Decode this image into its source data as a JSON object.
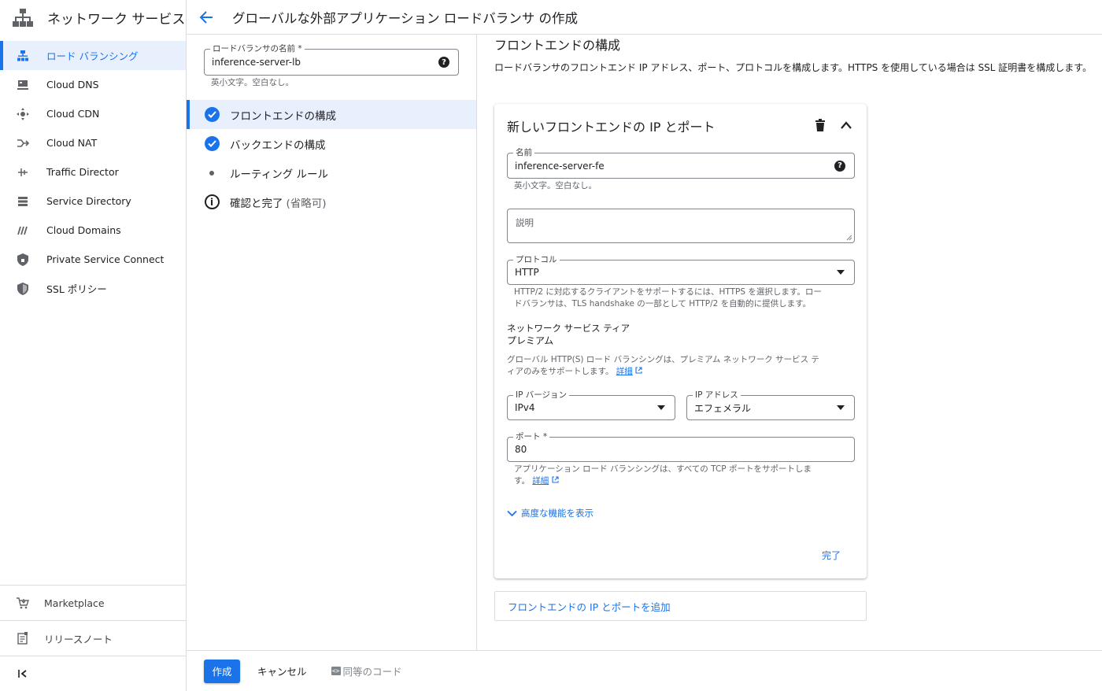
{
  "app": {
    "title": "ネットワーク サービス"
  },
  "sidebar": {
    "items": [
      {
        "label": "ロード バランシング",
        "icon": "load-balancer-icon",
        "active": true
      },
      {
        "label": "Cloud DNS",
        "icon": "dns-icon"
      },
      {
        "label": "Cloud CDN",
        "icon": "cdn-icon"
      },
      {
        "label": "Cloud NAT",
        "icon": "nat-icon"
      },
      {
        "label": "Traffic Director",
        "icon": "traffic-director-icon"
      },
      {
        "label": "Service Directory",
        "icon": "service-directory-icon"
      },
      {
        "label": "Cloud Domains",
        "icon": "domains-icon"
      },
      {
        "label": "Private Service Connect",
        "icon": "private-service-connect-icon"
      },
      {
        "label": "SSL ポリシー",
        "icon": "ssl-policy-icon"
      }
    ],
    "marketplace": "Marketplace",
    "release_notes": "リリースノート",
    "collapse_icon": "collapse-sidebar-icon"
  },
  "header": {
    "title": "グローバルな外部アプリケーション ロードバランサ の作成",
    "back_icon": "back-arrow-icon"
  },
  "lb_name": {
    "label": "ロードバランサの名前 *",
    "value": "inference-server-lb",
    "hint": "英小文字。空白なし。"
  },
  "steps": [
    {
      "label": "フロントエンドの構成",
      "state": "done",
      "active": true
    },
    {
      "label": "バックエンドの構成",
      "state": "done"
    },
    {
      "label": "ルーティング ルール",
      "state": "pending"
    },
    {
      "label": "確認と完了",
      "suffix": "(省略可)",
      "state": "info"
    }
  ],
  "main": {
    "heading": "フロントエンドの構成",
    "description": "ロードバランサのフロントエンド IP アドレス、ポート、プロトコルを構成します。HTTPS を使用している場合は SSL 証明書を構成します。",
    "card": {
      "title": "新しいフロントエンドの IP とポート",
      "name_label": "名前",
      "name_value": "inference-server-fe",
      "name_hint": "英小文字。空白なし。",
      "description_placeholder": "説明",
      "protocol_label": "プロトコル",
      "protocol_value": "HTTP",
      "protocol_hint_1": "HTTP/2 に対応するクライアントをサポートするには、HTTPS を選択します。ロー",
      "protocol_hint_2": "ドバランサは、TLS handshake の一部として HTTP/2 を自動的に提供します。",
      "tier_label": "ネットワーク サービス ティア",
      "tier_value": "プレミアム",
      "tier_hint_1": "グローバル HTTP(S) ロード バランシングは、プレミアム ネットワーク サービス テ",
      "tier_hint_2": "ィアのみをサポートします。",
      "details_link": "詳細",
      "ip_version_label": "IP バージョン",
      "ip_version_value": "IPv4",
      "ip_address_label": "IP アドレス",
      "ip_address_value": "エフェメラル",
      "port_label": "ポート *",
      "port_value": "80",
      "port_hint_1": "アプリケーション ロード バランシングは、すべての TCP ポートをサポートしま",
      "port_hint_2": "す。",
      "advanced_label": "高度な機能を表示",
      "done_label": "完了"
    },
    "add_frontend": "フロントエンドの IP とポートを追加"
  },
  "footer": {
    "create": "作成",
    "cancel": "キャンセル",
    "equivalent_code": "同等のコード"
  },
  "colors": {
    "accent": "#1a73e8",
    "active_bg": "#e8f0fe",
    "text": "#202124",
    "muted": "#5f6368"
  }
}
